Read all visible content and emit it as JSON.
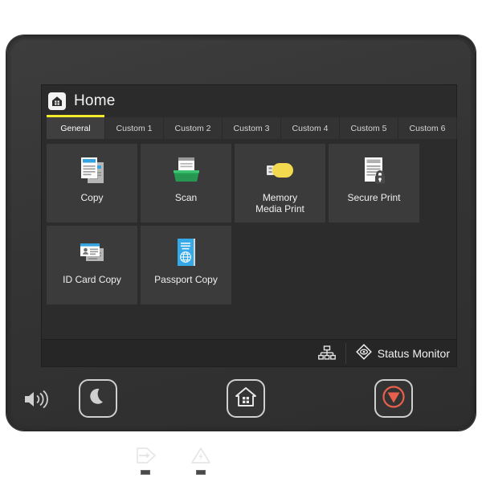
{
  "device": {
    "name": "printer-control-panel"
  },
  "screen": {
    "header": {
      "icon": "home-icon",
      "title": "Home"
    },
    "tabs": [
      {
        "label": "General",
        "active": true
      },
      {
        "label": "Custom 1",
        "active": false
      },
      {
        "label": "Custom 2",
        "active": false
      },
      {
        "label": "Custom 3",
        "active": false
      },
      {
        "label": "Custom 4",
        "active": false
      },
      {
        "label": "Custom 5",
        "active": false
      },
      {
        "label": "Custom 6",
        "active": false
      }
    ],
    "tiles": [
      {
        "label": "Copy",
        "icon": "copy-documents-icon"
      },
      {
        "label": "Scan",
        "icon": "scanner-icon"
      },
      {
        "label": "Memory\nMedia Print",
        "icon": "usb-drive-icon"
      },
      {
        "label": "Secure Print",
        "icon": "document-lock-icon"
      },
      {
        "label": "ID Card Copy",
        "icon": "id-card-icon"
      },
      {
        "label": "Passport Copy",
        "icon": "passport-icon"
      }
    ],
    "status_bar": {
      "network_icon": "network-tree-icon",
      "status_monitor_icon": "status-monitor-diamond-icon",
      "status_monitor_label": "Status Monitor"
    }
  },
  "hardware": {
    "speaker_icon": "speaker-volume-icon",
    "buttons": [
      {
        "name": "sleep",
        "icon": "moon-icon"
      },
      {
        "name": "home",
        "icon": "home-house-icon"
      },
      {
        "name": "stop",
        "icon": "stop-icon"
      }
    ],
    "indicators": [
      {
        "name": "data",
        "icon": "data-arrow-icon"
      },
      {
        "name": "error",
        "icon": "warning-triangle-icon"
      }
    ]
  },
  "colors": {
    "accent_yellow": "#f2ea2a",
    "stop_red": "#e8604c",
    "copy_blue": "#35a3dd",
    "scan_green": "#23a455",
    "usb_yellow": "#f2d94e",
    "passport_blue": "#35a8e8",
    "panel_dark": "#2c2c2c",
    "tile_gray": "#3b3b3b"
  }
}
